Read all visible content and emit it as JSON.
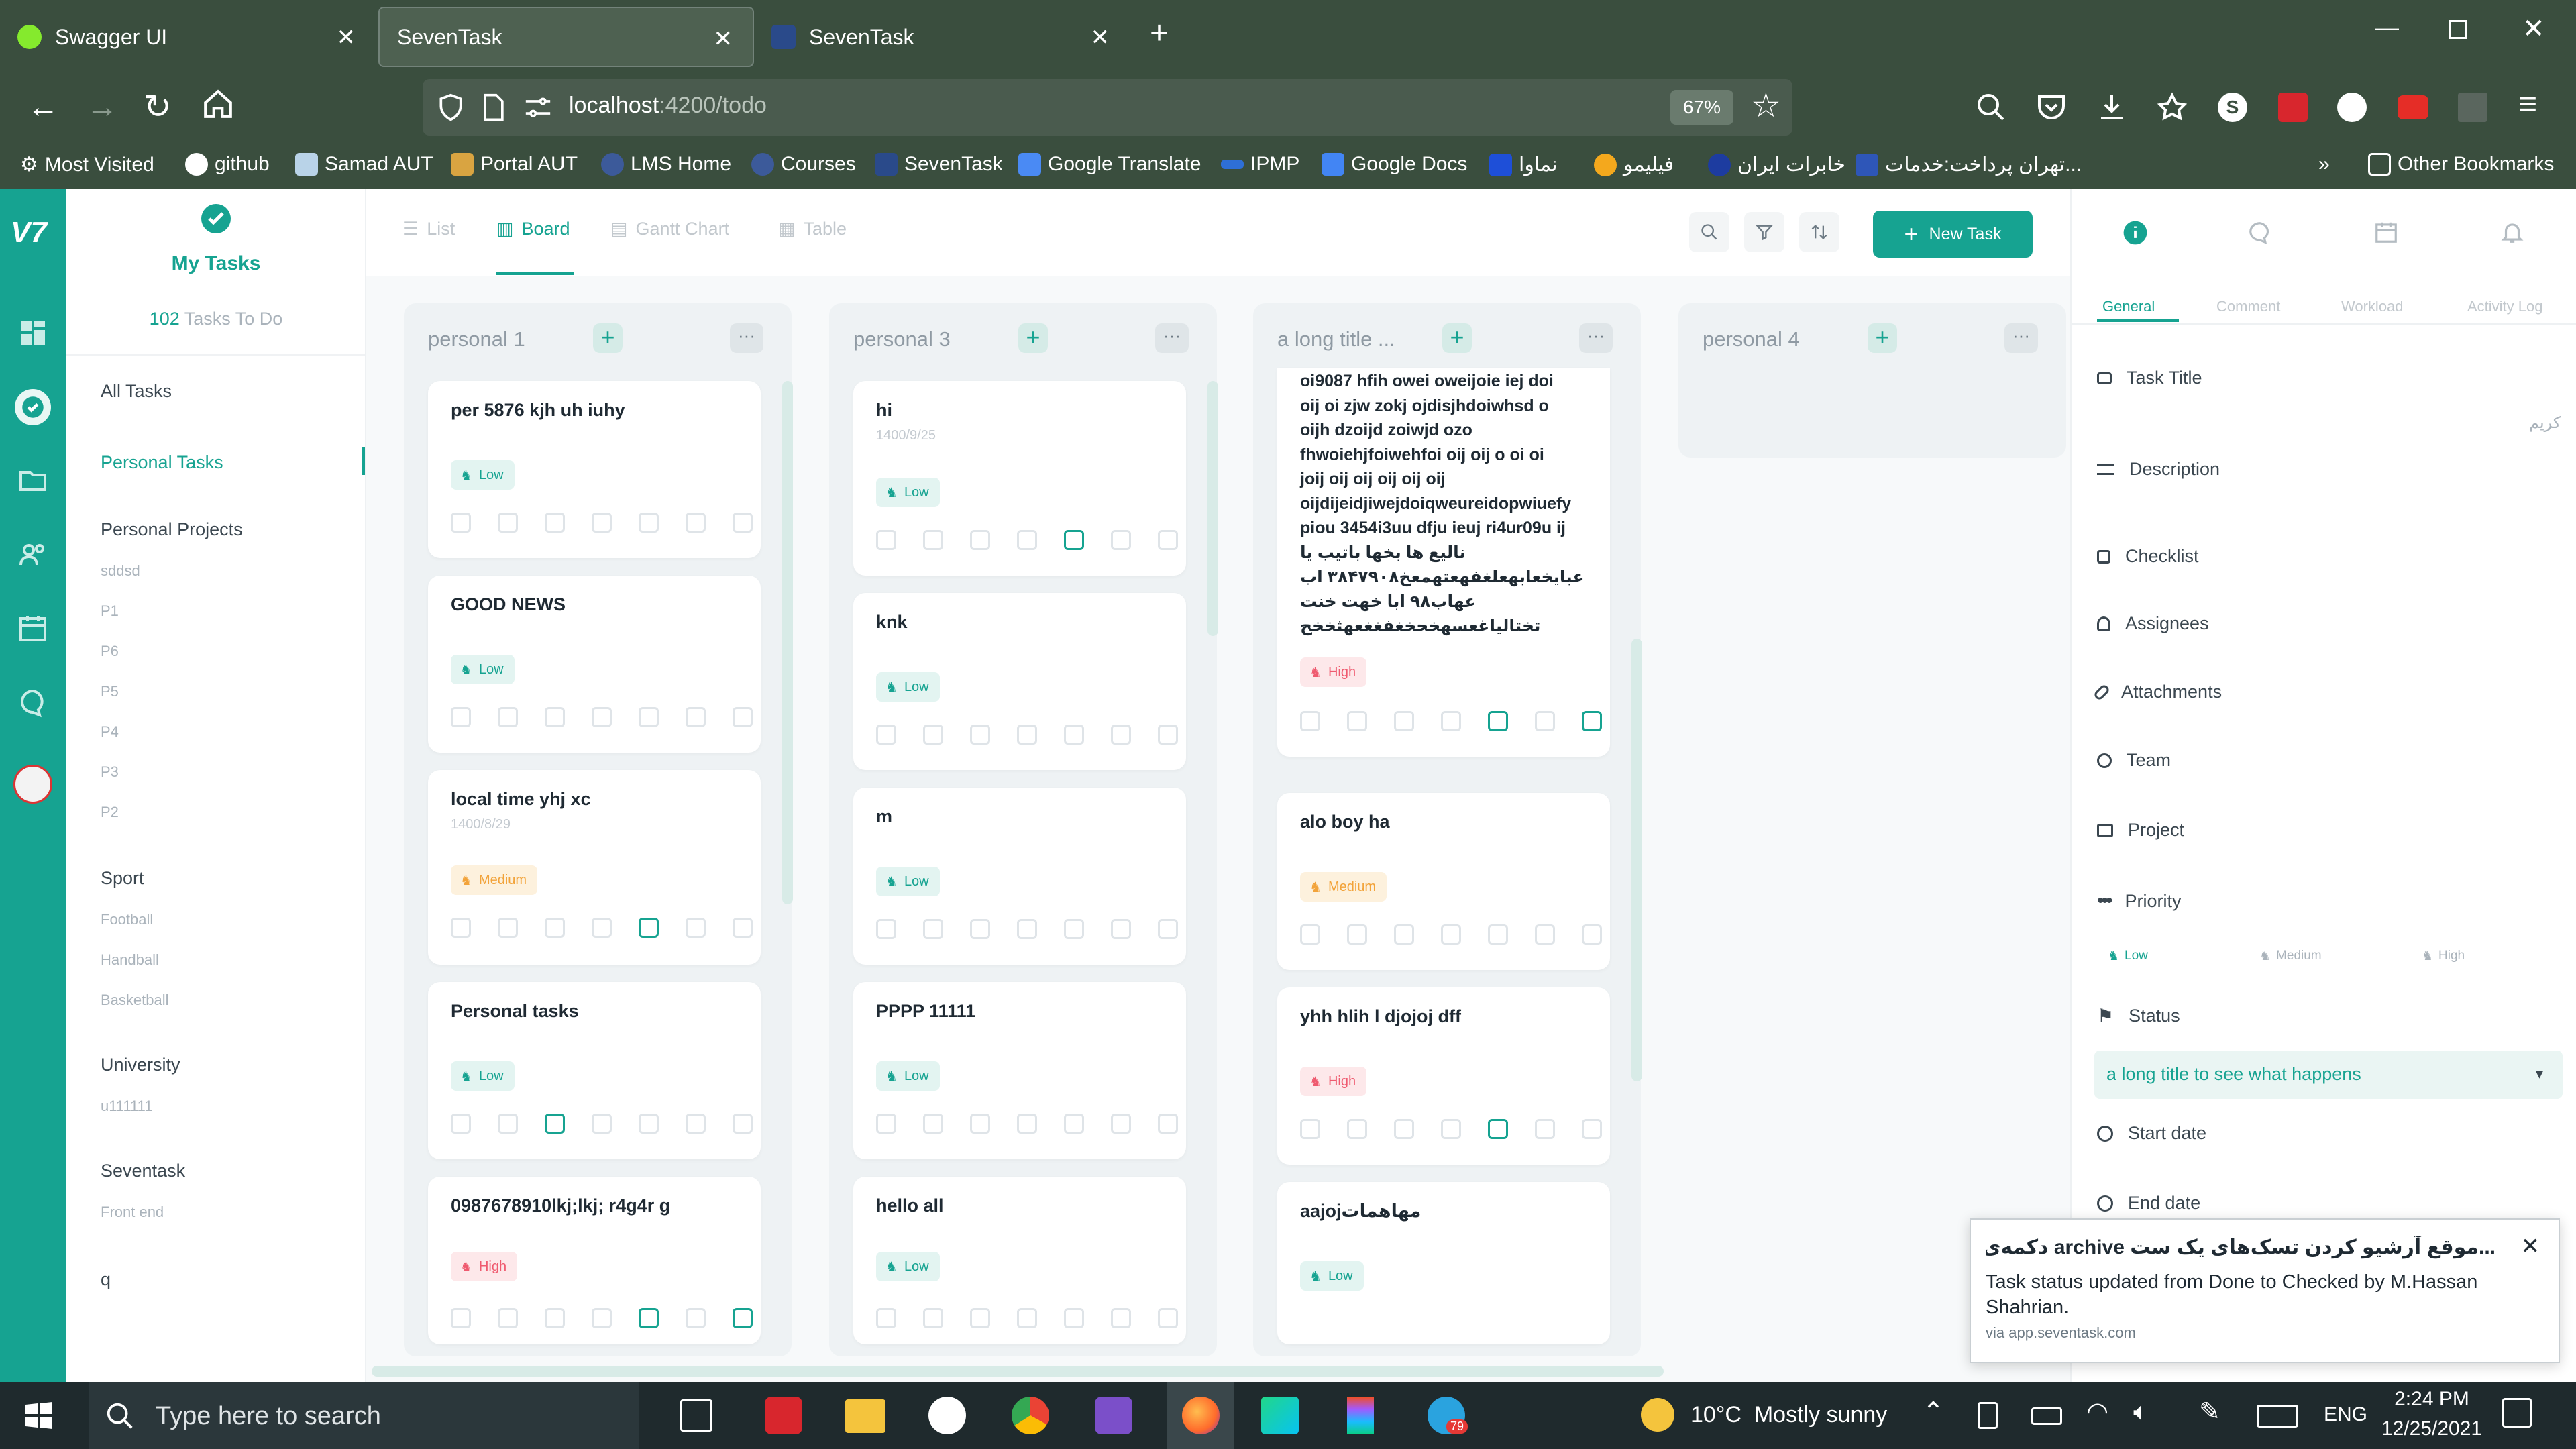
{
  "browser": {
    "tabs": [
      {
        "title": "Swagger UI"
      },
      {
        "title": "SevenTask"
      },
      {
        "title": "SevenTask"
      }
    ],
    "url_host": "localhost",
    "url_path": ":4200/todo",
    "zoom": "67%",
    "bookmarks": [
      "Most Visited",
      "github",
      "Samad AUT",
      "Portal AUT",
      "LMS Home",
      "Courses",
      "SevenTask",
      "Google Translate",
      "IPMP",
      "Google Docs",
      "نماوا",
      "فیلیمو",
      "خابرات ایران",
      "تهران پرداخت:خدمات...",
      "Other Bookmarks"
    ]
  },
  "app": {
    "logo": "V7",
    "sidebar": {
      "header": "My Tasks",
      "count": "102",
      "count_label": "Tasks To Do",
      "all_tasks": "All Tasks",
      "personal_tasks": "Personal Tasks",
      "personal_projects": "Personal Projects",
      "projects": [
        "sddsd",
        "P1",
        "P6",
        "P5",
        "P4",
        "P3",
        "P2"
      ],
      "sport": "Sport",
      "sport_items": [
        "Football",
        "Handball",
        "Basketball"
      ],
      "university": "University",
      "university_items": [
        "u111111"
      ],
      "seventask": "Seventask",
      "seventask_items": [
        "Front end"
      ],
      "q": "q"
    },
    "views": {
      "list": "List",
      "board": "Board",
      "gantt": "Gantt Chart",
      "table": "Table"
    },
    "new_task": "New Task",
    "columns": [
      {
        "title": "personal 1",
        "cards": [
          {
            "title": "per 5876 kjh uh iuhy",
            "priority": "Low"
          },
          {
            "title": "GOOD NEWS",
            "priority": "Low"
          },
          {
            "title": "local time yhj xc",
            "date": "1400/8/29",
            "priority": "Medium"
          },
          {
            "title": "Personal tasks",
            "priority": "Low"
          },
          {
            "title": "0987678910lkj;lkj; r4g4r g",
            "priority": "High"
          }
        ]
      },
      {
        "title": "personal 3",
        "cards": [
          {
            "title": "hi",
            "date": "1400/9/25",
            "priority": "Low"
          },
          {
            "title": "knk",
            "priority": "Low"
          },
          {
            "title": "m",
            "priority": "Low"
          },
          {
            "title": "PPPP 11111",
            "priority": "Low"
          },
          {
            "title": "hello all",
            "priority": "Low"
          }
        ]
      },
      {
        "title": "a long title ...",
        "cards": [
          {
            "long_text": [
              "oi9087 hfih owei oweijoie iej doi",
              "oij oi zjw zokj ojdisjhdoiwhsd o",
              "oijh dzoijd zoiwjd ozo",
              "fhwoiehjfoiwehfoi oij oij o oi oi",
              "joij oij oij oij oij oij",
              "oijdijeidjiwejdoiqweureidopwiuefy",
              "piou 3454i3uu dfju ieuj ri4ur09u ij",
              "نالیع ها بخها باتیب یا",
              "عبایخعابهعلغفهعتهمعخ۳۸۴۷۹۰۸ اب",
              "عهاب۹۸ ابا خهت خنت",
              "تختالیاغعسهخحخغفغغعهثخخح"
            ],
            "priority": "High"
          },
          {
            "title": "alo boy ha",
            "priority": "Medium"
          },
          {
            "title": "yhh hlih l djojoj dff",
            "priority": "High"
          },
          {
            "title": "aajojمهاهمات",
            "priority": "Low"
          }
        ]
      },
      {
        "title": "personal 4",
        "cards": []
      }
    ],
    "panel": {
      "tabs": [
        "General",
        "Comment",
        "Workload",
        "Activity Log"
      ],
      "task_title": "Task Title",
      "rtl_placeholder": "کریم",
      "description": "Description",
      "checklist": "Checklist",
      "assignees": "Assignees",
      "attachments": "Attachments",
      "team": "Team",
      "project": "Project",
      "priority": "Priority",
      "priority_options": [
        "Low",
        "Medium",
        "High"
      ],
      "status": "Status",
      "status_value": "a long title to see what happens",
      "start_date": "Start date",
      "end_date": "End date"
    },
    "toast": {
      "title": "...موقع آرشیو کردن تسک‌های یک ست archive دکمه‌ی",
      "body": "Task status updated from Done to Checked by M.Hassan Shahrian.",
      "via": "via app.seventask.com"
    }
  },
  "taskbar": {
    "search_placeholder": "Type here to search",
    "weather": "10°C  Mostly sunny",
    "lang": "ENG",
    "time": "2:24 PM",
    "date": "12/25/2021",
    "telegram_badge": "79"
  },
  "colors": {
    "accent": "#16a391",
    "chrome": "#3a4e3e",
    "low": "#16a391",
    "medium": "#f2a33a",
    "high": "#ef5a6f"
  }
}
